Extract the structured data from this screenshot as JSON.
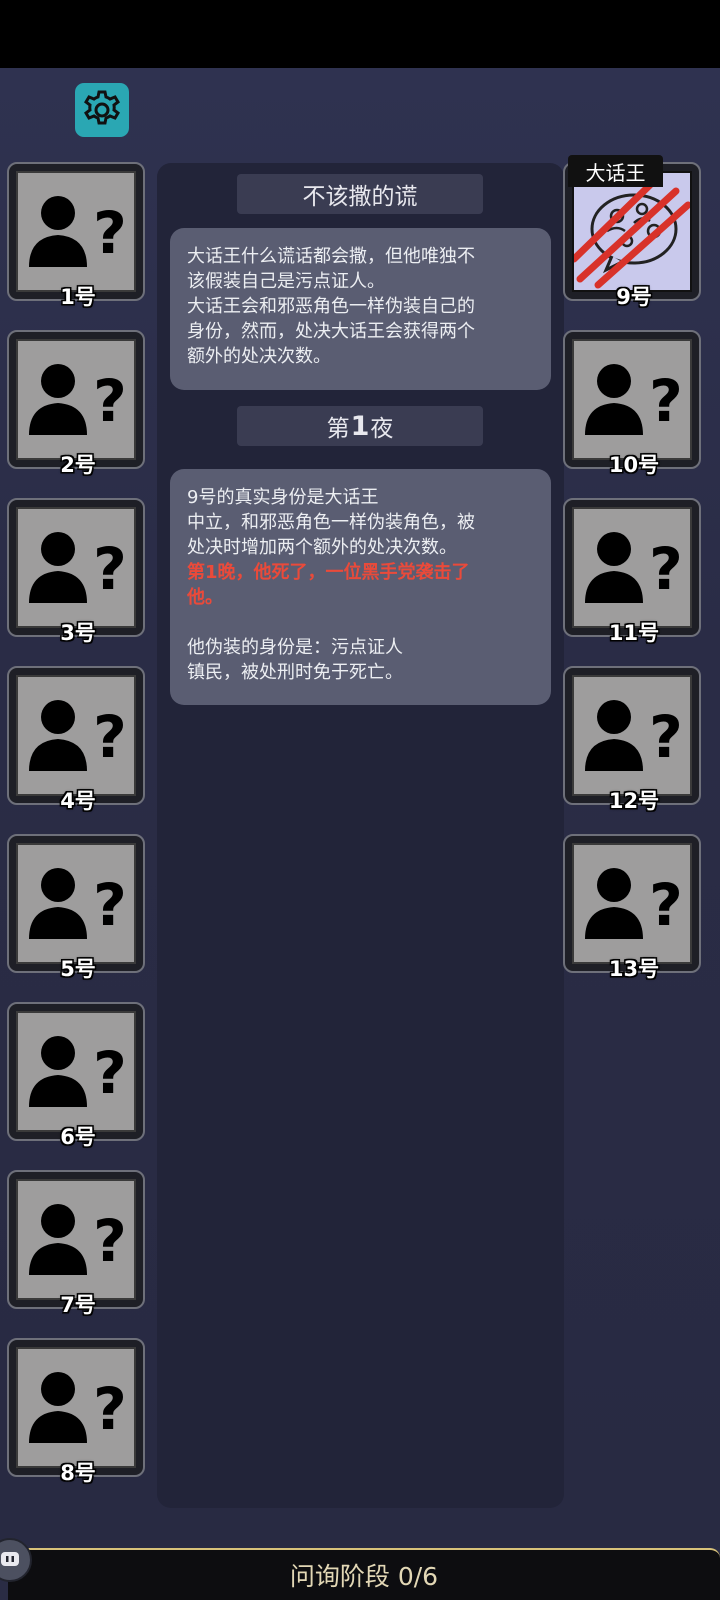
{
  "settings": {
    "icon": "gear-icon"
  },
  "section1": {
    "title": "不该撒的谎",
    "lines": [
      "大话王什么谎话都会撒，但他唯独不",
      "该假装自己是污点证人。",
      "大话王会和邪恶角色一样伪装自己的",
      "身份，然而，处决大话王会获得两个",
      "额外的处决次数。"
    ]
  },
  "section2": {
    "title_prefix": "第",
    "title_num": "1",
    "title_suffix": "夜",
    "line1": "9号的真实身份是大话王",
    "line2": "中立，和邪恶角色一样伪装角色，被",
    "line3": "处决时增加两个额外的处决次数。",
    "red1": "第1晚，他死了，一位黑手党袭击了",
    "red2": "他。",
    "line4": "他伪装的身份是：污点证人",
    "line5": "镇民，被处刑时免于死亡。"
  },
  "players_left": [
    {
      "label": "1号"
    },
    {
      "label": "2号"
    },
    {
      "label": "3号"
    },
    {
      "label": "4号"
    },
    {
      "label": "5号"
    },
    {
      "label": "6号"
    },
    {
      "label": "7号"
    },
    {
      "label": "8号"
    }
  ],
  "players_right": [
    {
      "label": "9号",
      "role": "大话王",
      "status": "dead"
    },
    {
      "label": "10号"
    },
    {
      "label": "11号"
    },
    {
      "label": "12号"
    },
    {
      "label": "13号"
    }
  ],
  "phase": {
    "text": "问询阶段 0/6"
  },
  "colors": {
    "accent": "#2aa7b3",
    "danger": "#ea4a3a",
    "panel": "#5a5d72"
  }
}
